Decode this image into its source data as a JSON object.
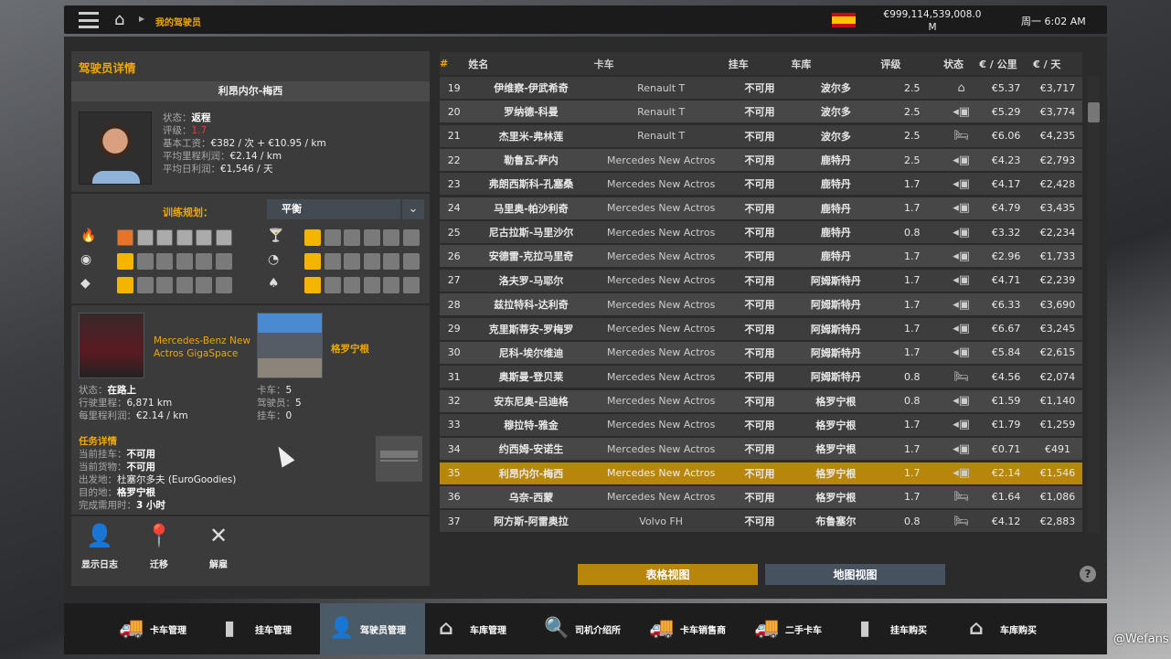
{
  "topbar": {
    "breadcrumb": "我的驾驶员",
    "money": "€999,114,539,008.0",
    "money_unit": "M",
    "time": "周一 6:02 AM"
  },
  "driver": {
    "panel_title": "驾驶员详情",
    "name": "利昂内尔-梅西",
    "status_label": "状态：",
    "status": "返程",
    "rating_label": "评级：",
    "rating": "1.7",
    "salary_label": "基本工资：",
    "salary": "€382 / 次 + €10.95 / km",
    "avg_km_label": "平均里程利润：",
    "avg_km": "€2.14 / km",
    "avg_day_label": "平均日利润：",
    "avg_day": "€1,546 / 天",
    "training_label": "训练规划：",
    "training_value": "平衡",
    "skills": {
      "adr": 6,
      "long_distance": 1,
      "valuable": 1,
      "fragile": 1,
      "urgent": 1,
      "eco": 1
    },
    "skill_max": 6
  },
  "truck": {
    "name": "Mercedes-Benz New Actros GigaSpace",
    "status_label": "状态：",
    "status": "在路上",
    "odo_label": "行驶里程：",
    "odo": "6,871 km",
    "profit_label": "每里程利润：",
    "profit": "€2.14 / km"
  },
  "garage": {
    "name": "格罗宁根",
    "trucks_label": "卡车：",
    "trucks": "5",
    "drivers_label": "驾驶员：",
    "drivers": "5",
    "trailers_label": "挂车：",
    "trailers": "0"
  },
  "job": {
    "title": "任务详情",
    "trailer_label": "当前挂车：",
    "trailer": "不可用",
    "cargo_label": "当前货物：",
    "cargo": "不可用",
    "from_label": "出发地：",
    "from": "杜塞尔多夫 (EuroGoodies)",
    "to_label": "目的地：",
    "to": "格罗宁根",
    "time_label": "完成需用时：",
    "time": "3 小时"
  },
  "actions": [
    {
      "label": "显示日志",
      "icon": "log-icon"
    },
    {
      "label": "迁移",
      "icon": "relocate-icon"
    },
    {
      "label": "解雇",
      "icon": "fire-icon"
    }
  ],
  "table": {
    "headers": [
      "#",
      "姓名",
      "卡车",
      "挂车",
      "车库",
      "评级",
      "状态",
      "€ / 公里",
      "€ / 天"
    ],
    "selected": "35",
    "rows": [
      [
        "19",
        "伊维察-伊武希奇",
        "Renault T",
        "不可用",
        "波尔多",
        "2.5",
        "garage",
        "€5.37",
        "€3,717"
      ],
      [
        "20",
        "罗纳德-科曼",
        "Renault T",
        "不可用",
        "波尔多",
        "2.5",
        "driving",
        "€5.29",
        "€3,774"
      ],
      [
        "21",
        "杰里米-弗林莲",
        "Renault T",
        "不可用",
        "波尔多",
        "2.5",
        "resting",
        "€6.06",
        "€4,235"
      ],
      [
        "22",
        "勒鲁瓦-萨内",
        "Mercedes New Actros",
        "不可用",
        "鹿特丹",
        "2.5",
        "driving",
        "€4.23",
        "€2,793"
      ],
      [
        "23",
        "弗朗西斯科-孔塞桑",
        "Mercedes New Actros",
        "不可用",
        "鹿特丹",
        "1.7",
        "driving",
        "€4.17",
        "€2,428"
      ],
      [
        "24",
        "马里奥-帕沙利奇",
        "Mercedes New Actros",
        "不可用",
        "鹿特丹",
        "1.7",
        "driving",
        "€4.79",
        "€3,435"
      ],
      [
        "25",
        "尼古拉斯-马里沙尔",
        "Mercedes New Actros",
        "不可用",
        "鹿特丹",
        "0.8",
        "driving",
        "€3.32",
        "€2,234"
      ],
      [
        "26",
        "安德雷-克拉马里奇",
        "Mercedes New Actros",
        "不可用",
        "鹿特丹",
        "1.7",
        "driving",
        "€2.96",
        "€1,733"
      ],
      [
        "27",
        "洛夫罗-马耶尔",
        "Mercedes New Actros",
        "不可用",
        "阿姆斯特丹",
        "1.7",
        "driving",
        "€4.71",
        "€2,239"
      ],
      [
        "28",
        "兹拉特科-达利奇",
        "Mercedes New Actros",
        "不可用",
        "阿姆斯特丹",
        "1.7",
        "driving",
        "€6.33",
        "€3,690"
      ],
      [
        "29",
        "克里斯蒂安-罗梅罗",
        "Mercedes New Actros",
        "不可用",
        "阿姆斯特丹",
        "1.7",
        "driving",
        "€6.67",
        "€3,245"
      ],
      [
        "30",
        "尼科-埃尔维迪",
        "Mercedes New Actros",
        "不可用",
        "阿姆斯特丹",
        "1.7",
        "driving",
        "€5.84",
        "€2,615"
      ],
      [
        "31",
        "奥斯曼-登贝莱",
        "Mercedes New Actros",
        "不可用",
        "阿姆斯特丹",
        "0.8",
        "resting",
        "€4.56",
        "€2,074"
      ],
      [
        "32",
        "安东尼奥-吕迪格",
        "Mercedes New Actros",
        "不可用",
        "格罗宁根",
        "0.8",
        "driving",
        "€1.59",
        "€1,140"
      ],
      [
        "33",
        "穆拉特-雅金",
        "Mercedes New Actros",
        "不可用",
        "格罗宁根",
        "1.7",
        "driving",
        "€1.79",
        "€1,259"
      ],
      [
        "34",
        "约西姆-安诺生",
        "Mercedes New Actros",
        "不可用",
        "格罗宁根",
        "1.7",
        "driving",
        "€0.71",
        "€491"
      ],
      [
        "35",
        "利昂内尔-梅西",
        "Mercedes New Actros",
        "不可用",
        "格罗宁根",
        "1.7",
        "driving",
        "€2.14",
        "€1,546"
      ],
      [
        "36",
        "乌奈-西蒙",
        "Mercedes New Actros",
        "不可用",
        "格罗宁根",
        "1.7",
        "resting",
        "€1.64",
        "€1,086"
      ],
      [
        "37",
        "阿方斯-阿雷奥拉",
        "Volvo FH",
        "不可用",
        "布鲁塞尔",
        "0.8",
        "resting",
        "€4.12",
        "€2,883"
      ]
    ]
  },
  "views": {
    "table": "表格视图",
    "map": "地图视图"
  },
  "nav": [
    {
      "label": "卡车管理"
    },
    {
      "label": "挂车管理"
    },
    {
      "label": "驾驶员管理",
      "active": true
    },
    {
      "label": "车库管理"
    },
    {
      "label": "司机介绍所"
    },
    {
      "label": "卡车销售商"
    },
    {
      "label": "二手卡车"
    },
    {
      "label": "挂车购买"
    },
    {
      "label": "车库购买"
    }
  ],
  "watermark": "@Wefans",
  "colors": {
    "accent": "#f0a800",
    "selected_row": "#b8860b",
    "active_nav": "#4b5a67"
  }
}
